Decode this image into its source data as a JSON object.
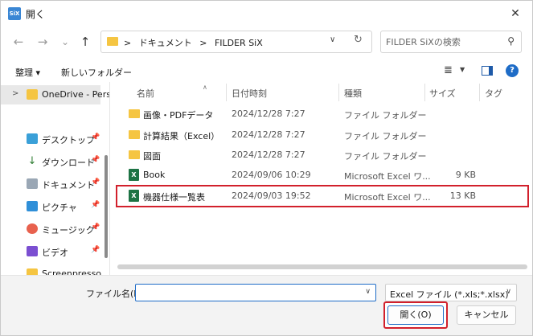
{
  "window": {
    "title": "開く",
    "app_icon": "SiX"
  },
  "nav": {
    "back_icon": "←",
    "forward_icon": "→",
    "down_icon": "⌄",
    "up_icon": "↑",
    "breadcrumb": [
      ">",
      "ドキュメント",
      ">",
      "FILDER SiX"
    ],
    "search_placeholder": "FILDER SiXの検索"
  },
  "toolbar": {
    "organize": "整理 ▾",
    "new_folder": "新しいフォルダー"
  },
  "sidebar": {
    "items": [
      {
        "label": "OneDrive - Perso",
        "chevron": ">",
        "color": "#f5c542",
        "pinned": false
      },
      {
        "label": "デスクトップ",
        "color": "#3aa0d8",
        "pinned": true
      },
      {
        "label": "ダウンロード",
        "color": "#2e7d32",
        "pinned": true
      },
      {
        "label": "ドキュメント",
        "color": "#9aa7b5",
        "pinned": true
      },
      {
        "label": "ピクチャ",
        "color": "#2f8fd8",
        "pinned": true
      },
      {
        "label": "ミュージック",
        "color": "#e8614e",
        "pinned": true
      },
      {
        "label": "ビデオ",
        "color": "#7b4fd1",
        "pinned": true
      },
      {
        "label": "Screenpresso",
        "color": "#f5c542",
        "pinned": false
      }
    ]
  },
  "columns": {
    "name": "名前",
    "date": "日付時刻",
    "type": "種類",
    "size": "サイズ",
    "tag": "タグ"
  },
  "files": [
    {
      "name": "画像・PDFデータ",
      "date": "2024/12/28 7:27",
      "type": "ファイル フォルダー",
      "size": "",
      "kind": "folder"
    },
    {
      "name": "計算結果（Excel）",
      "date": "2024/12/28 7:27",
      "type": "ファイル フォルダー",
      "size": "",
      "kind": "folder"
    },
    {
      "name": "図面",
      "date": "2024/12/28 7:27",
      "type": "ファイル フォルダー",
      "size": "",
      "kind": "folder"
    },
    {
      "name": "Book",
      "date": "2024/09/06 10:29",
      "type": "Microsoft Excel ワ...",
      "size": "9 KB",
      "kind": "excel"
    },
    {
      "name": "機器仕様一覧表",
      "date": "2024/09/03 19:52",
      "type": "Microsoft Excel ワ...",
      "size": "13 KB",
      "kind": "excel"
    }
  ],
  "bottom": {
    "filename_label": "ファイル名(N):",
    "filename_value": "",
    "filetype": "Excel ファイル (*.xls;*.xlsx)",
    "open_label": "開く(O)",
    "cancel_label": "キャンセル"
  },
  "colors": {
    "accent": "#1e6cc7",
    "highlight": "#d2202c",
    "folder": "#f5c542",
    "excel": "#1d7344"
  }
}
